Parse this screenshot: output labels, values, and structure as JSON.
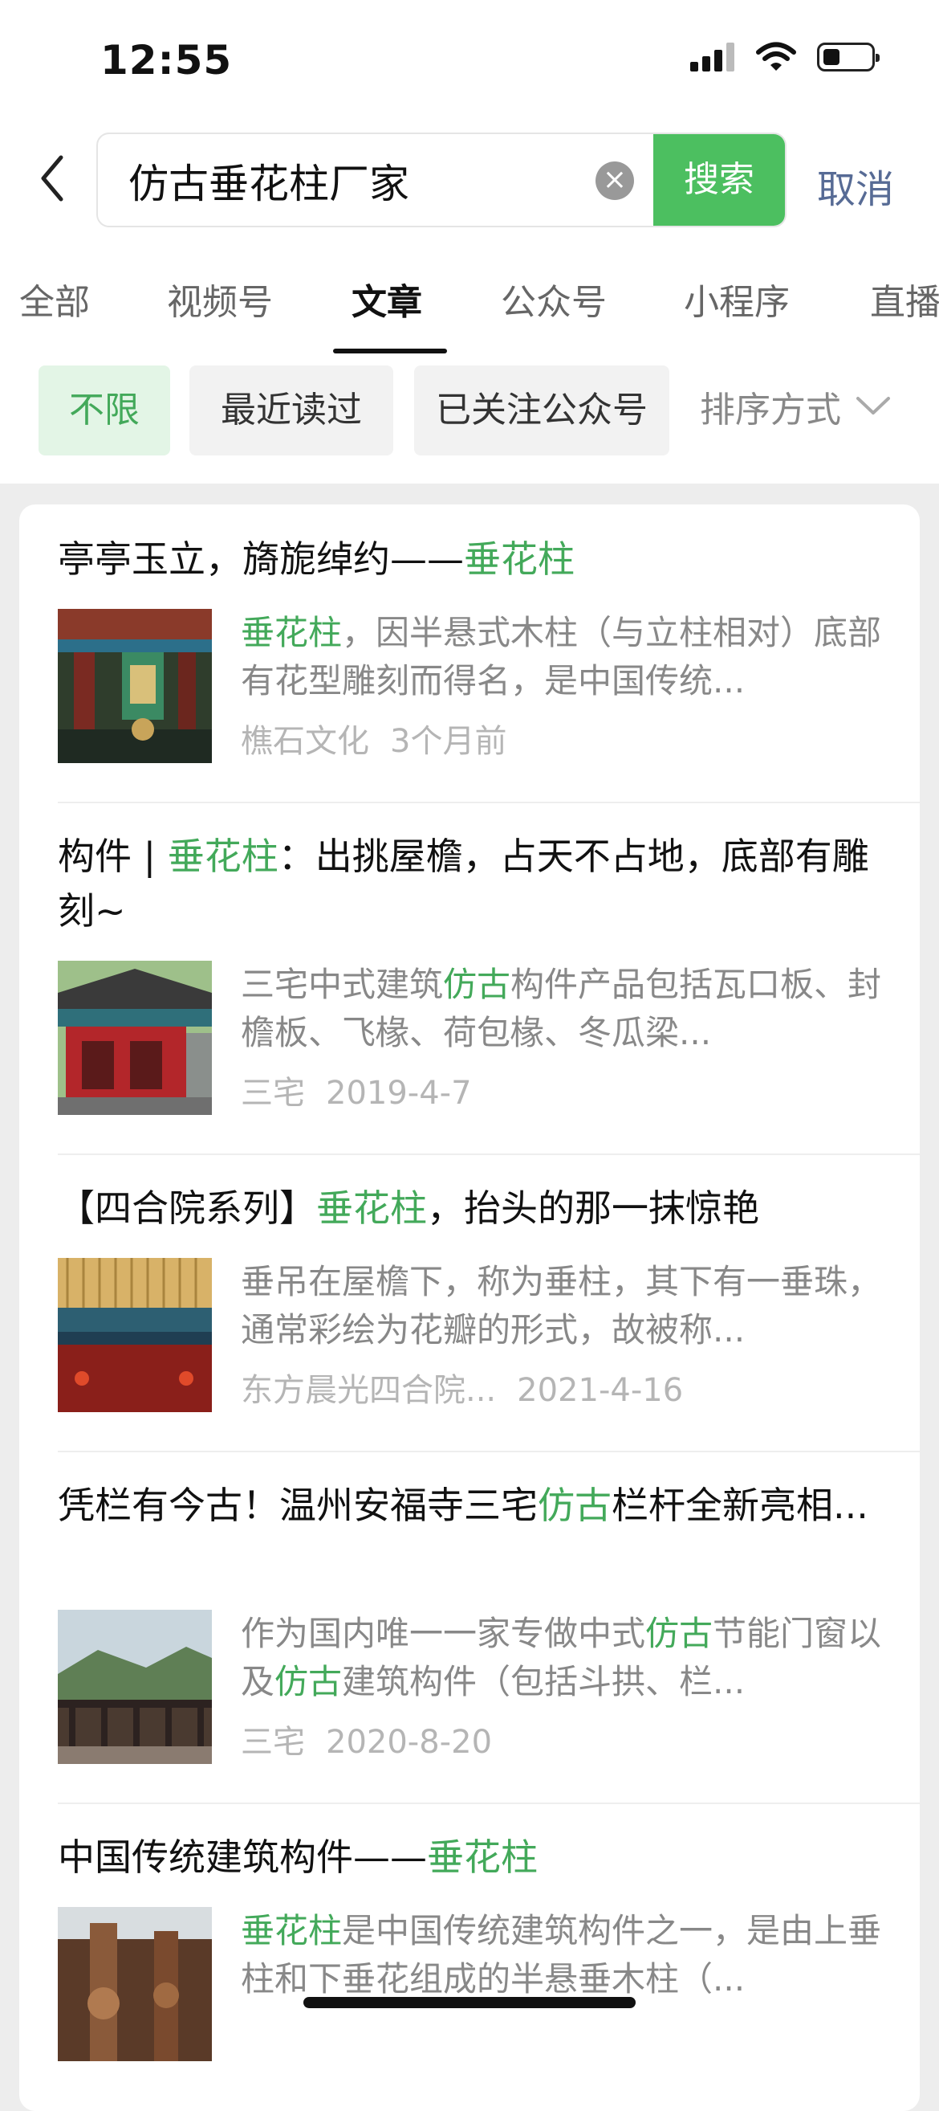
{
  "status_bar": {
    "time": "12:55"
  },
  "search": {
    "query": "仿古垂花柱厂家",
    "search_label": "搜索",
    "cancel_label": "取消"
  },
  "tabs": [
    {
      "label": "全部"
    },
    {
      "label": "视频号"
    },
    {
      "label": "文章",
      "active": true
    },
    {
      "label": "公众号"
    },
    {
      "label": "小程序"
    },
    {
      "label": "直播"
    }
  ],
  "filters": [
    {
      "label": "不限",
      "active": true
    },
    {
      "label": "最近读过"
    },
    {
      "label": "已关注公众号"
    }
  ],
  "sort_label": "排序方式",
  "highlight_color": "#43a95a",
  "results": [
    {
      "title": [
        {
          "t": "亭亭玉立，旖旎绰约——"
        },
        {
          "t": "垂花柱",
          "hl": true
        }
      ],
      "snippet": [
        {
          "t": "垂花柱",
          "hl": true
        },
        {
          "t": "，因半悬式木柱（与立柱相对）底部有花型雕刻而得名，是中国传统..."
        }
      ],
      "source": "樵石文化",
      "date": "3个月前",
      "thumb_icon": "ornate-painted-bracket-photo"
    },
    {
      "title": [
        {
          "t": "构件 | "
        },
        {
          "t": "垂花柱",
          "hl": true
        },
        {
          "t": "：出挑屋檐，占天不占地，底部有雕刻~"
        }
      ],
      "snippet": [
        {
          "t": "三宅中式建筑"
        },
        {
          "t": "仿古",
          "hl": true
        },
        {
          "t": "构件产品包括瓦口板、封檐板、飞椽、荷包椽、冬瓜梁..."
        }
      ],
      "source": "三宅",
      "date": "2019-4-7",
      "thumb_icon": "red-pavilion-photo"
    },
    {
      "title": [
        {
          "t": "【四合院系列】"
        },
        {
          "t": "垂花柱",
          "hl": true
        },
        {
          "t": "，抬头的那一抹惊艳"
        }
      ],
      "snippet": [
        {
          "t": "垂吊在屋檐下，称为垂柱，其下有一垂珠，通常彩绘为花瓣的形式，故被称..."
        }
      ],
      "source": "东方晨光四合院...",
      "date": "2021-4-16",
      "thumb_icon": "tiled-eave-photo"
    },
    {
      "title": [
        {
          "t": "凭栏有今古！温州安福寺三宅"
        },
        {
          "t": "仿古",
          "hl": true
        },
        {
          "t": "栏杆全新亮相..."
        }
      ],
      "snippet": [
        {
          "t": "作为国内唯一一家专做中式"
        },
        {
          "t": "仿古",
          "hl": true
        },
        {
          "t": "节能门窗以及"
        },
        {
          "t": "仿古",
          "hl": true
        },
        {
          "t": "建筑构件（包括斗拱、栏..."
        }
      ],
      "source": "三宅",
      "date": "2020-8-20",
      "thumb_icon": "mountain-railing-photo"
    },
    {
      "title": [
        {
          "t": "中国传统建筑构件——"
        },
        {
          "t": "垂花柱",
          "hl": true
        }
      ],
      "snippet": [
        {
          "t": "垂花柱",
          "hl": true
        },
        {
          "t": "是中国传统建筑构件之一，是由上垂柱和下垂花组成的半悬垂木柱（..."
        }
      ],
      "source": "",
      "date": "",
      "thumb_icon": "carved-wood-photo"
    }
  ]
}
